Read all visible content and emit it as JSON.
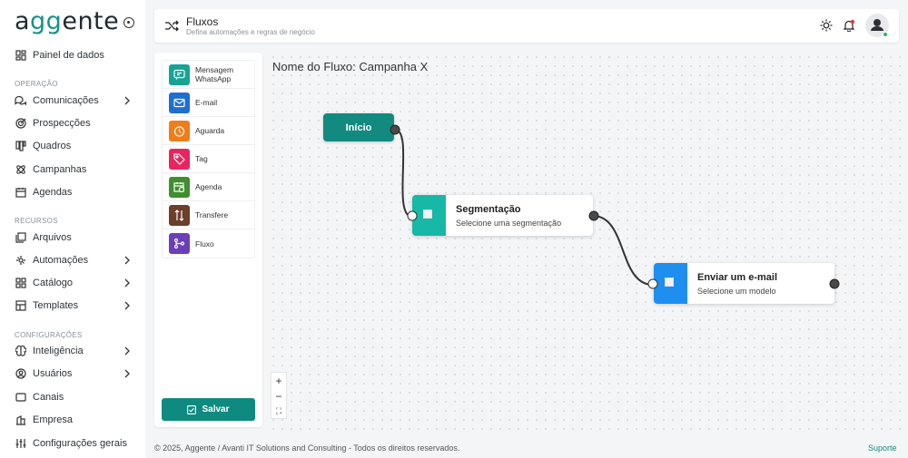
{
  "brand": {
    "logo_pre": "a",
    "logo_gg": "gg",
    "logo_post": "ente"
  },
  "sidebar": {
    "items": [
      {
        "label": "Painel de dados"
      },
      {
        "label": "Comunicações"
      },
      {
        "label": "Prospecções"
      },
      {
        "label": "Quadros"
      },
      {
        "label": "Campanhas"
      },
      {
        "label": "Agendas"
      },
      {
        "label": "Arquivos"
      },
      {
        "label": "Automações"
      },
      {
        "label": "Catálogo"
      },
      {
        "label": "Templates"
      },
      {
        "label": "Inteligência"
      },
      {
        "label": "Usuários"
      },
      {
        "label": "Canais"
      },
      {
        "label": "Empresa"
      },
      {
        "label": "Configurações gerais"
      }
    ],
    "sections": {
      "operacao": "OPERAÇÃO",
      "recursos": "RECURSOS",
      "configuracoes": "CONFIGURAÇÕES"
    }
  },
  "header": {
    "title": "Fluxos",
    "subtitle": "Defina automações e regras de negócio"
  },
  "palette": {
    "items": [
      {
        "label_1": "Mensagem",
        "label_2": "WhatsApp",
        "color": "#16a394"
      },
      {
        "label_1": "E-mail",
        "label_2": "",
        "color": "#1f6fd1"
      },
      {
        "label_1": "Aguarda",
        "label_2": "",
        "color": "#ef7d1a"
      },
      {
        "label_1": "Tag",
        "label_2": "",
        "color": "#e8245e"
      },
      {
        "label_1": "Agenda",
        "label_2": "",
        "color": "#3f8f2f"
      },
      {
        "label_1": "Transfere",
        "label_2": "",
        "color": "#6b3f2a"
      },
      {
        "label_1": "Fluxo",
        "label_2": "",
        "color": "#6a3fb8"
      }
    ],
    "save_label": "Salvar"
  },
  "canvas": {
    "flow_name": "Nome do Fluxo: Campanha X",
    "start_label": "Início",
    "nodes": [
      {
        "title": "Segmentação",
        "subtitle": "Selecione uma segmentação",
        "color": "#17b8a6"
      },
      {
        "title": "Enviar um e-mail",
        "subtitle": "Selecione um modelo",
        "color": "#1e8ef0"
      }
    ],
    "zoom": {
      "in": "+",
      "out": "−",
      "fit": "⛶"
    }
  },
  "footer": {
    "copyright": "© 2025, Aggente / Avanti IT Solutions and Consulting - Todos os direitos reservados.",
    "support": "Suporte"
  },
  "colors": {
    "accent": "#138a80"
  }
}
